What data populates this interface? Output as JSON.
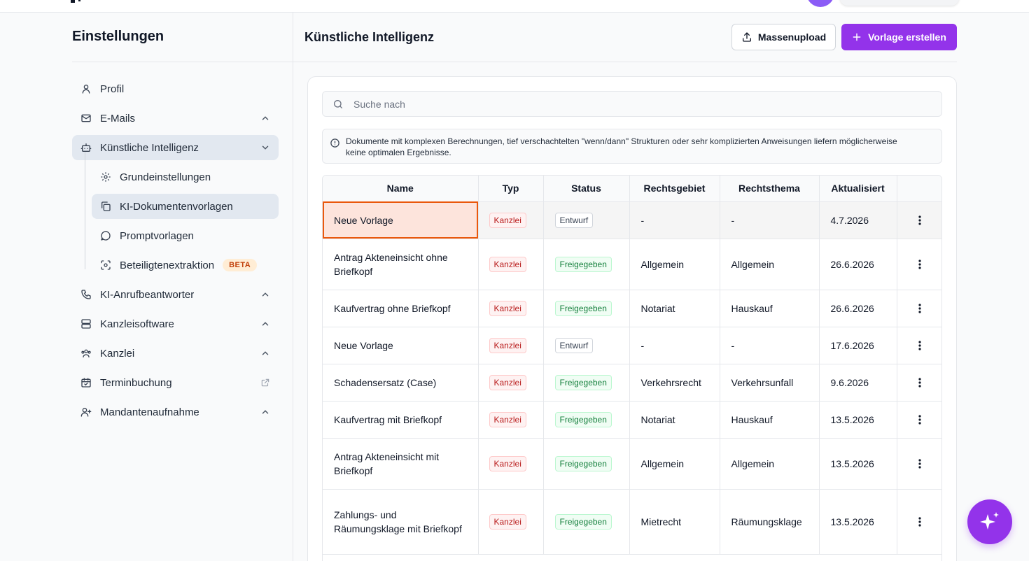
{
  "sidebar": {
    "title": "Einstellungen",
    "items": [
      {
        "label": "Profil"
      },
      {
        "label": "E-Mails"
      },
      {
        "label": "Künstliche Intelligenz"
      },
      {
        "label": "Grundeinstellungen"
      },
      {
        "label": "KI-Dokumentenvorlagen"
      },
      {
        "label": "Promptvorlagen"
      },
      {
        "label": "Beteiligtenextraktion",
        "badge": "BETA"
      },
      {
        "label": "KI-Anrufbeantworter"
      },
      {
        "label": "Kanzleisoftware"
      },
      {
        "label": "Kanzlei"
      },
      {
        "label": "Terminbuchung"
      },
      {
        "label": "Mandantenaufnahme"
      }
    ]
  },
  "main": {
    "title": "Künstliche Intelligenz",
    "upload_label": "Massenupload",
    "create_label": "Vorlage erstellen",
    "search_placeholder": "Suche nach",
    "notice": "Dokumente mit komplexen Berechnungen, tief verschachtelten \"wenn/dann\" Strukturen oder sehr komplizierten Anweisungen liefern möglicherweise keine optimalen Ergebnisse."
  },
  "table": {
    "headers": [
      "Name",
      "Typ",
      "Status",
      "Rechtsgebiet",
      "Rechtsthema",
      "Aktualisiert",
      ""
    ],
    "rows": [
      {
        "name": "Neue Vorlage",
        "type": "Kanzlei",
        "status": "Entwurf",
        "area": "-",
        "topic": "-",
        "updated": "4.7.2026"
      },
      {
        "name": "Antrag Akteneinsicht ohne Briefkopf",
        "type": "Kanzlei",
        "status": "Freigegeben",
        "area": "Allgemein",
        "topic": "Allgemein",
        "updated": "26.6.2026"
      },
      {
        "name": "Kaufvertrag ohne Briefkopf",
        "type": "Kanzlei",
        "status": "Freigegeben",
        "area": "Notariat",
        "topic": "Hauskauf",
        "updated": "26.6.2026"
      },
      {
        "name": "Neue Vorlage",
        "type": "Kanzlei",
        "status": "Entwurf",
        "area": "-",
        "topic": "-",
        "updated": "17.6.2026"
      },
      {
        "name": "Schadensersatz (Case)",
        "type": "Kanzlei",
        "status": "Freigegeben",
        "area": "Verkehrsrecht",
        "topic": "Verkehrsunfall",
        "updated": "9.6.2026"
      },
      {
        "name": "Kaufvertrag mit Briefkopf",
        "type": "Kanzlei",
        "status": "Freigegeben",
        "area": "Notariat",
        "topic": "Hauskauf",
        "updated": "13.5.2026"
      },
      {
        "name": "Antrag Akteneinsicht mit Briefkopf",
        "type": "Kanzlei",
        "status": "Freigegeben",
        "area": "Allgemein",
        "topic": "Allgemein",
        "updated": "13.5.2026"
      },
      {
        "name": "Zahlungs- und Räumungsklage mit Briefkopf",
        "type": "Kanzlei",
        "status": "Freigegeben",
        "area": "Mietrecht",
        "topic": "Räumungsklage",
        "updated": "13.5.2026"
      }
    ]
  },
  "colors": {
    "accent": "#9333ea",
    "kanzlei": "#b91c1c",
    "approved": "#15803d",
    "highlight": "#ea580c"
  }
}
